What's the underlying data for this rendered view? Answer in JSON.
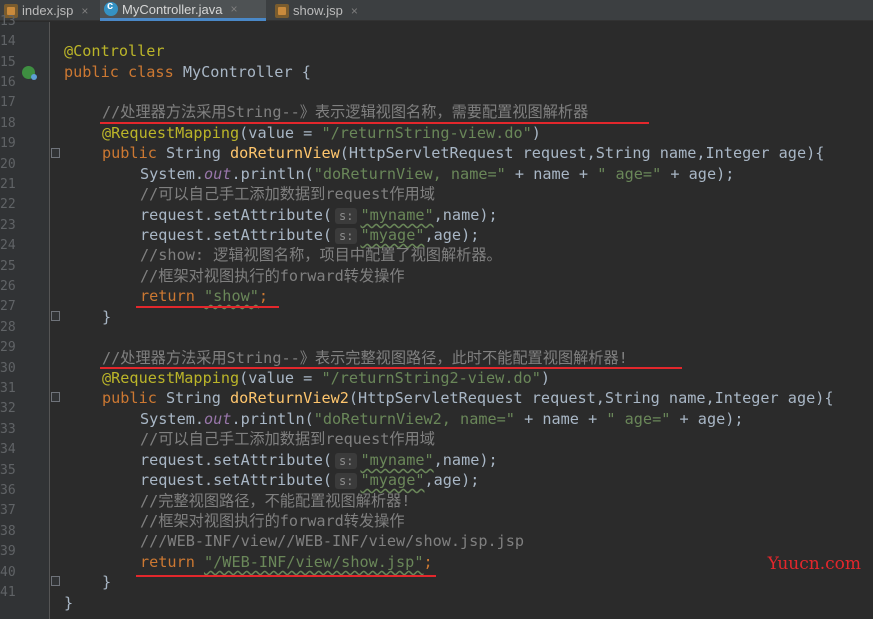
{
  "tabs": [
    {
      "label": "index.jsp",
      "icon": "jsp-file-icon",
      "active": false
    },
    {
      "label": "MyController.java",
      "icon": "java-class-icon",
      "active": true
    },
    {
      "label": "show.jsp",
      "icon": "jsp-file-icon",
      "active": false
    }
  ],
  "tab_close_glyph": "×",
  "line_numbers": [
    "13",
    "14",
    "15",
    "16",
    "17",
    "18",
    "19",
    "20",
    "21",
    "22",
    "23",
    "24",
    "25",
    "26",
    "27",
    "28",
    "29",
    "30",
    "31",
    "32",
    "33",
    "34",
    "35",
    "36",
    "37",
    "38",
    "39",
    "40",
    "41"
  ],
  "code": {
    "l14": {
      "ann": "@Controller"
    },
    "l15": {
      "kw": "public class ",
      "name": "MyController {"
    },
    "l17": {
      "cmt": "//处理器方法采用String--》表示逻辑视图名称，需要配置视图解析器"
    },
    "l18": {
      "ann": "@RequestMapping",
      "p1": "(value = ",
      "str": "\"/returnString-view.do\"",
      "p2": ")"
    },
    "l19": {
      "kw": "public ",
      "t": "String ",
      "fn": "doReturnView",
      "rest": "(HttpServletRequest request,String name,Integer age){"
    },
    "l20": {
      "a": "System.",
      "field": "out",
      "b": ".println(",
      "s1": "\"doReturnView, name=\"",
      "c": " + name + ",
      "s2": "\" age=\"",
      "d": " + age);"
    },
    "l21": {
      "cmt": "//可以自己手工添加数据到request作用域"
    },
    "l22": {
      "a": "request.setAttribute(",
      "hint": "s:",
      "str": "\"myname\"",
      "b": ",name);"
    },
    "l23": {
      "a": "request.setAttribute(",
      "hint": "s:",
      "str": "\"myage\"",
      "b": ",age);"
    },
    "l24": {
      "cmt": "//show: 逻辑视图名称，项目中配置了视图解析器。"
    },
    "l25": {
      "cmt": "//框架对视图执行的forward转发操作"
    },
    "l26": {
      "kw": "return ",
      "str": "\"show\"",
      "b": ";"
    },
    "l27": {
      "text": "}"
    },
    "l29": {
      "cmt": "//处理器方法采用String--》表示完整视图路径，此时不能配置视图解析器!"
    },
    "l30": {
      "ann": "@RequestMapping",
      "p1": "(value = ",
      "str": "\"/returnString2-view.do\"",
      "p2": ")"
    },
    "l31": {
      "kw": "public ",
      "t": "String ",
      "fn": "doReturnView2",
      "rest": "(HttpServletRequest request,String name,Integer age){"
    },
    "l32": {
      "a": "System.",
      "field": "out",
      "b": ".println(",
      "s1": "\"doReturnView2, name=\"",
      "c": " + name + ",
      "s2": "\" age=\"",
      "d": " + age);"
    },
    "l33": {
      "cmt": "//可以自己手工添加数据到request作用域"
    },
    "l34": {
      "a": "request.setAttribute(",
      "hint": "s:",
      "str": "\"myname\"",
      "b": ",name);"
    },
    "l35": {
      "a": "request.setAttribute(",
      "hint": "s:",
      "str": "\"myage\"",
      "b": ",age);"
    },
    "l36": {
      "cmt": "//完整视图路径，不能配置视图解析器!"
    },
    "l37": {
      "cmt": "//框架对视图执行的forward转发操作"
    },
    "l38": {
      "cmt": "///WEB-INF/view//WEB-INF/view/show.jsp.jsp"
    },
    "l39": {
      "kw": "return ",
      "str": "\"/WEB-INF/view/show.jsp\"",
      "b": ";"
    },
    "l40": {
      "text": "}"
    },
    "l41": {
      "text": "}"
    }
  },
  "watermark": "Yuucn.com",
  "colors": {
    "background": "#2b2b2b",
    "keyword": "#cc7832",
    "annotation": "#bbb529",
    "string": "#6a8759",
    "comment": "#808080",
    "method": "#ffc66d",
    "markup_underline": "#e3272c"
  }
}
